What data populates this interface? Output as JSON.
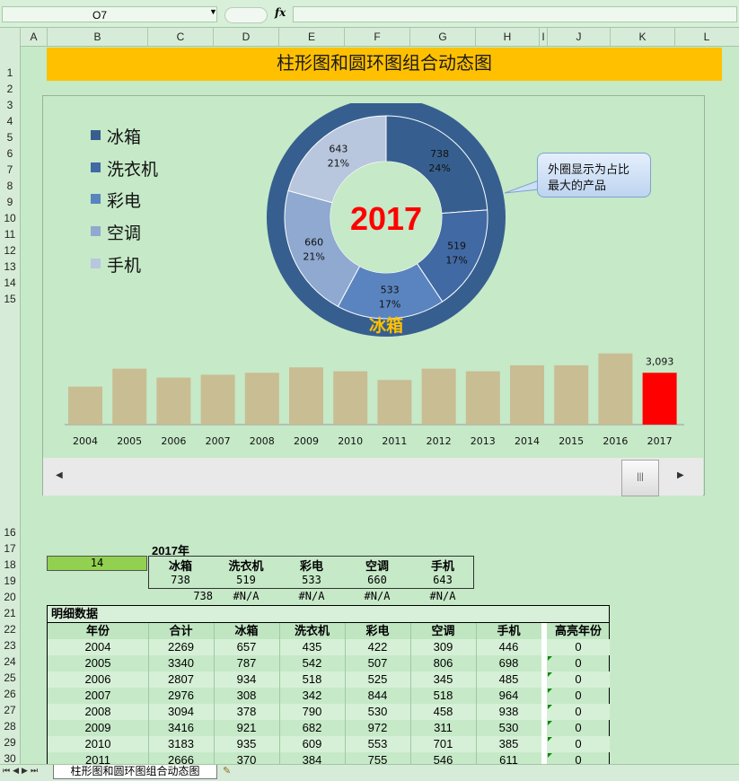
{
  "formula_bar": {
    "name_box": "O7",
    "fx_label": "fx",
    "formula": ""
  },
  "columns": [
    "A",
    "B",
    "C",
    "D",
    "E",
    "F",
    "G",
    "H",
    "I",
    "J",
    "K",
    "L"
  ],
  "rows": [
    "1",
    "2",
    "3",
    "4",
    "5",
    "6",
    "7",
    "8",
    "9",
    "10",
    "11",
    "12",
    "13",
    "14",
    "15",
    "16",
    "17",
    "18",
    "19",
    "20",
    "21",
    "22",
    "23",
    "24",
    "25",
    "26",
    "27",
    "28",
    "29",
    "30"
  ],
  "title": "柱形图和圆环图组合动态图",
  "chart_data": [
    {
      "type": "pie",
      "subtype": "doughnut",
      "center_label": "2017",
      "outer_label": "冰箱",
      "legend": [
        "冰箱",
        "洗衣机",
        "彩电",
        "空调",
        "手机"
      ],
      "slices": [
        {
          "name": "冰箱",
          "value": 738,
          "percent": "24%",
          "color": "#365f8f"
        },
        {
          "name": "洗衣机",
          "value": 519,
          "percent": "17%",
          "color": "#4169a3"
        },
        {
          "name": "彩电",
          "value": 533,
          "percent": "17%",
          "color": "#5a84bf"
        },
        {
          "name": "空调",
          "value": 660,
          "percent": "21%",
          "color": "#8fa9d0"
        },
        {
          "name": "手机",
          "value": 643,
          "percent": "21%",
          "color": "#b8c6de"
        }
      ]
    },
    {
      "type": "bar",
      "categories": [
        "2004",
        "2005",
        "2006",
        "2007",
        "2008",
        "2009",
        "2010",
        "2011",
        "2012",
        "2013",
        "2014",
        "2015",
        "2016",
        "2017"
      ],
      "values": [
        2269,
        3340,
        2807,
        2976,
        3094,
        3416,
        3183,
        2666,
        3340,
        3183,
        3540,
        3540,
        4250,
        3093
      ],
      "highlight": {
        "category": "2017",
        "label": "3,093",
        "color": "#ff0000"
      },
      "bar_color": "#c9bd93",
      "ylim": [
        0,
        4500
      ]
    }
  ],
  "callout": {
    "line1": "外圈显示为占比",
    "line2": "最大的产品"
  },
  "summary": {
    "year_label": "2017年",
    "index_value": "14",
    "headers": [
      "冰箱",
      "洗衣机",
      "彩电",
      "空调",
      "手机"
    ],
    "values": [
      "738",
      "519",
      "533",
      "660",
      "643"
    ],
    "row20": [
      "738",
      "#N/A",
      "#N/A",
      "#N/A",
      "#N/A"
    ]
  },
  "detail": {
    "title": "明细数据",
    "headers": [
      "年份",
      "合计",
      "冰箱",
      "洗衣机",
      "彩电",
      "空调",
      "手机",
      "高亮年份"
    ],
    "rows": [
      [
        "2004",
        "2269",
        "657",
        "435",
        "422",
        "309",
        "446",
        "0"
      ],
      [
        "2005",
        "3340",
        "787",
        "542",
        "507",
        "806",
        "698",
        "0"
      ],
      [
        "2006",
        "2807",
        "934",
        "518",
        "525",
        "345",
        "485",
        "0"
      ],
      [
        "2007",
        "2976",
        "308",
        "342",
        "844",
        "518",
        "964",
        "0"
      ],
      [
        "2008",
        "3094",
        "378",
        "790",
        "530",
        "458",
        "938",
        "0"
      ],
      [
        "2009",
        "3416",
        "921",
        "682",
        "972",
        "311",
        "530",
        "0"
      ],
      [
        "2010",
        "3183",
        "935",
        "609",
        "553",
        "701",
        "385",
        "0"
      ],
      [
        "2011",
        "2666",
        "370",
        "384",
        "755",
        "546",
        "611",
        "0"
      ]
    ]
  },
  "sheet_tab": "柱形图和圆环图组合动态图",
  "colors": {
    "title_bg": "#ffc000",
    "sheet_bg": "#c6e9c8",
    "index_cell": "#92d050",
    "detail_header": "#d8efd9"
  }
}
